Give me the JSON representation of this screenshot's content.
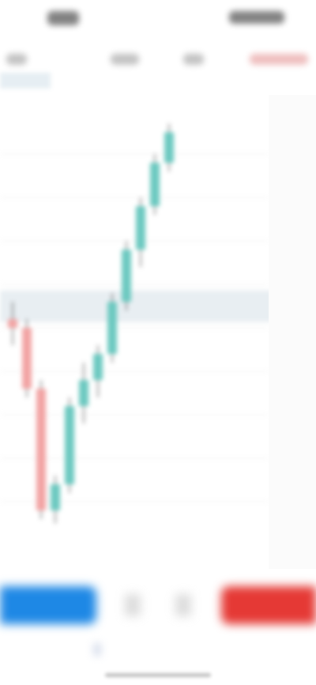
{
  "colors": {
    "background": "#ffffff",
    "up_candle": "#6cc9c0",
    "down_candle": "#f2a4a4",
    "wick": "#333333",
    "sell": "#1e88e5",
    "buy": "#e53935",
    "price_line": "#e8eef2",
    "grid": "#eeeeee"
  },
  "icons": [
    "signal-icon",
    "wifi-icon",
    "battery-icon"
  ],
  "chart_data": {
    "type": "candlestick",
    "title": "",
    "xlabel": "",
    "ylabel": "",
    "ylim": [
      0,
      1
    ],
    "candles": [
      {
        "o": 0.52,
        "h": 0.56,
        "l": 0.46,
        "c": 0.5
      },
      {
        "o": 0.5,
        "h": 0.52,
        "l": 0.34,
        "c": 0.36
      },
      {
        "o": 0.36,
        "h": 0.38,
        "l": 0.06,
        "c": 0.08
      },
      {
        "o": 0.08,
        "h": 0.16,
        "l": 0.05,
        "c": 0.14
      },
      {
        "o": 0.14,
        "h": 0.34,
        "l": 0.12,
        "c": 0.32
      },
      {
        "o": 0.32,
        "h": 0.42,
        "l": 0.28,
        "c": 0.38
      },
      {
        "o": 0.38,
        "h": 0.46,
        "l": 0.34,
        "c": 0.44
      },
      {
        "o": 0.44,
        "h": 0.58,
        "l": 0.42,
        "c": 0.56
      },
      {
        "o": 0.56,
        "h": 0.7,
        "l": 0.54,
        "c": 0.68
      },
      {
        "o": 0.68,
        "h": 0.8,
        "l": 0.64,
        "c": 0.78
      },
      {
        "o": 0.78,
        "h": 0.9,
        "l": 0.76,
        "c": 0.88
      },
      {
        "o": 0.88,
        "h": 0.97,
        "l": 0.86,
        "c": 0.95
      }
    ],
    "price_line": 0.55
  }
}
